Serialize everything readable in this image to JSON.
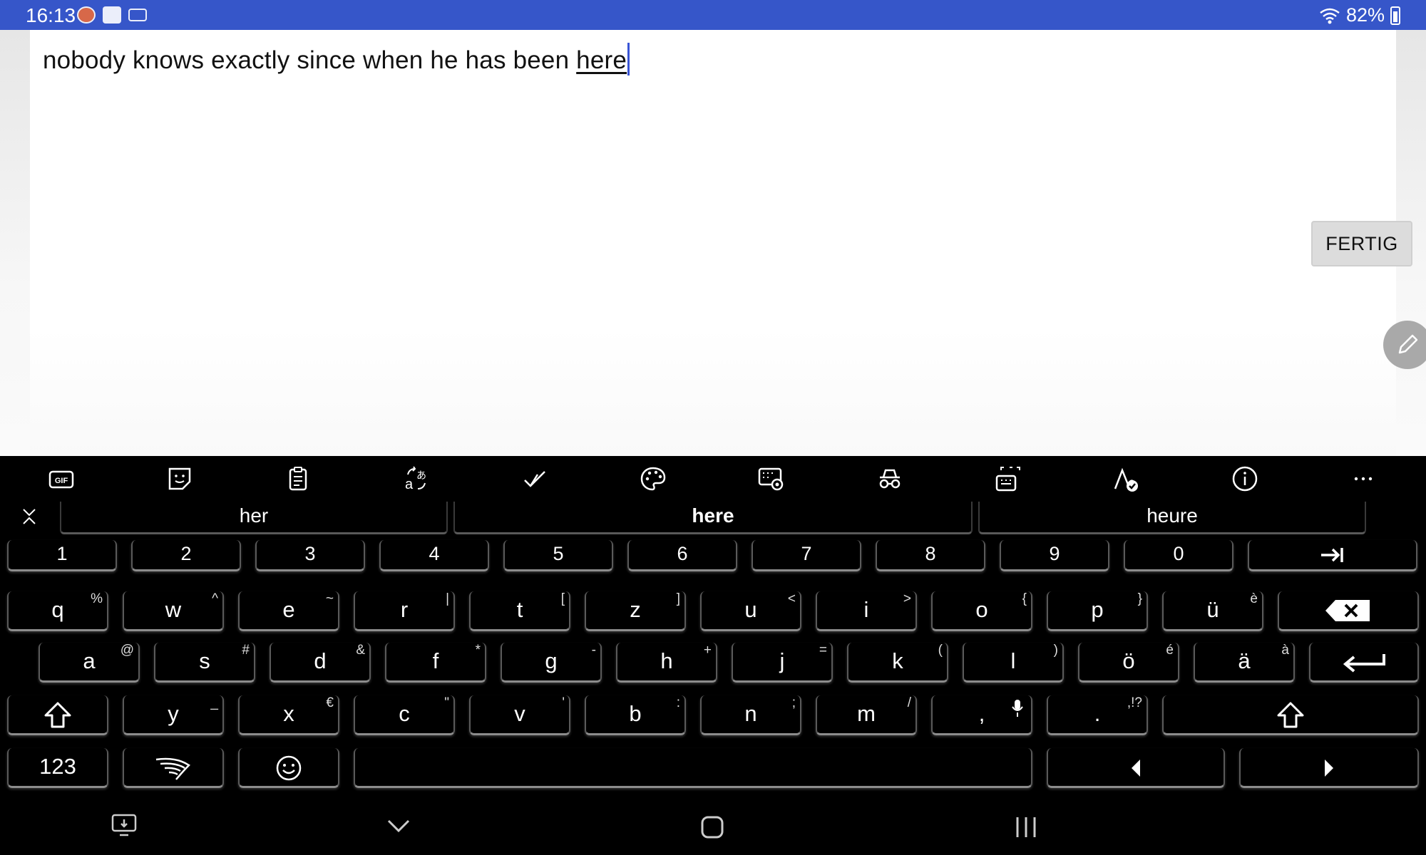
{
  "status_bar": {
    "time": "16:13",
    "battery": "82%",
    "icons": [
      "app-notification-icon",
      "contact-card-icon",
      "keyboard-icon",
      "wifi-icon",
      "battery-icon"
    ]
  },
  "editor": {
    "text_before": "nobody knows exactly since when he has been ",
    "composing_word": "here",
    "done_button": "FERTIG"
  },
  "keyboard": {
    "toolbar_icons": [
      "gif-icon",
      "sticker-icon",
      "clipboard-icon",
      "translate-icon",
      "checkmark-icon",
      "palette-icon",
      "keyboard-settings-icon",
      "incognito-icon",
      "resize-keyboard-icon",
      "handwriting-icon",
      "info-icon",
      "more-icon"
    ],
    "suggestions": [
      "her",
      "here",
      "heure"
    ],
    "number_row": [
      "1",
      "2",
      "3",
      "4",
      "5",
      "6",
      "7",
      "8",
      "9",
      "0"
    ],
    "row1": [
      {
        "k": "q",
        "a": "%"
      },
      {
        "k": "w",
        "a": "^"
      },
      {
        "k": "e",
        "a": "~"
      },
      {
        "k": "r",
        "a": "|"
      },
      {
        "k": "t",
        "a": "["
      },
      {
        "k": "z",
        "a": "]"
      },
      {
        "k": "u",
        "a": "<"
      },
      {
        "k": "i",
        "a": ">"
      },
      {
        "k": "o",
        "a": "{"
      },
      {
        "k": "p",
        "a": "}"
      },
      {
        "k": "ü",
        "a": "è"
      }
    ],
    "row2": [
      {
        "k": "a",
        "a": "@"
      },
      {
        "k": "s",
        "a": "#"
      },
      {
        "k": "d",
        "a": "&"
      },
      {
        "k": "f",
        "a": "*"
      },
      {
        "k": "g",
        "a": "-"
      },
      {
        "k": "h",
        "a": "+"
      },
      {
        "k": "j",
        "a": "="
      },
      {
        "k": "k",
        "a": "("
      },
      {
        "k": "l",
        "a": ")"
      },
      {
        "k": "ö",
        "a": "é"
      },
      {
        "k": "ä",
        "a": "à"
      }
    ],
    "row3": [
      {
        "k": "y",
        "a": "_"
      },
      {
        "k": "x",
        "a": "€"
      },
      {
        "k": "c",
        "a": "\""
      },
      {
        "k": "v",
        "a": "'"
      },
      {
        "k": "b",
        "a": ":"
      },
      {
        "k": "n",
        "a": ";"
      },
      {
        "k": "m",
        "a": "/"
      },
      {
        "k": ",",
        "a": ""
      },
      {
        "k": ".",
        "a": ",!?"
      }
    ],
    "symbols_key": "123"
  },
  "colors": {
    "status_bar": "#3656c9",
    "caret": "#3a55d6",
    "keyboard_bg": "#000000",
    "done_button_bg": "#dcdcdc"
  }
}
